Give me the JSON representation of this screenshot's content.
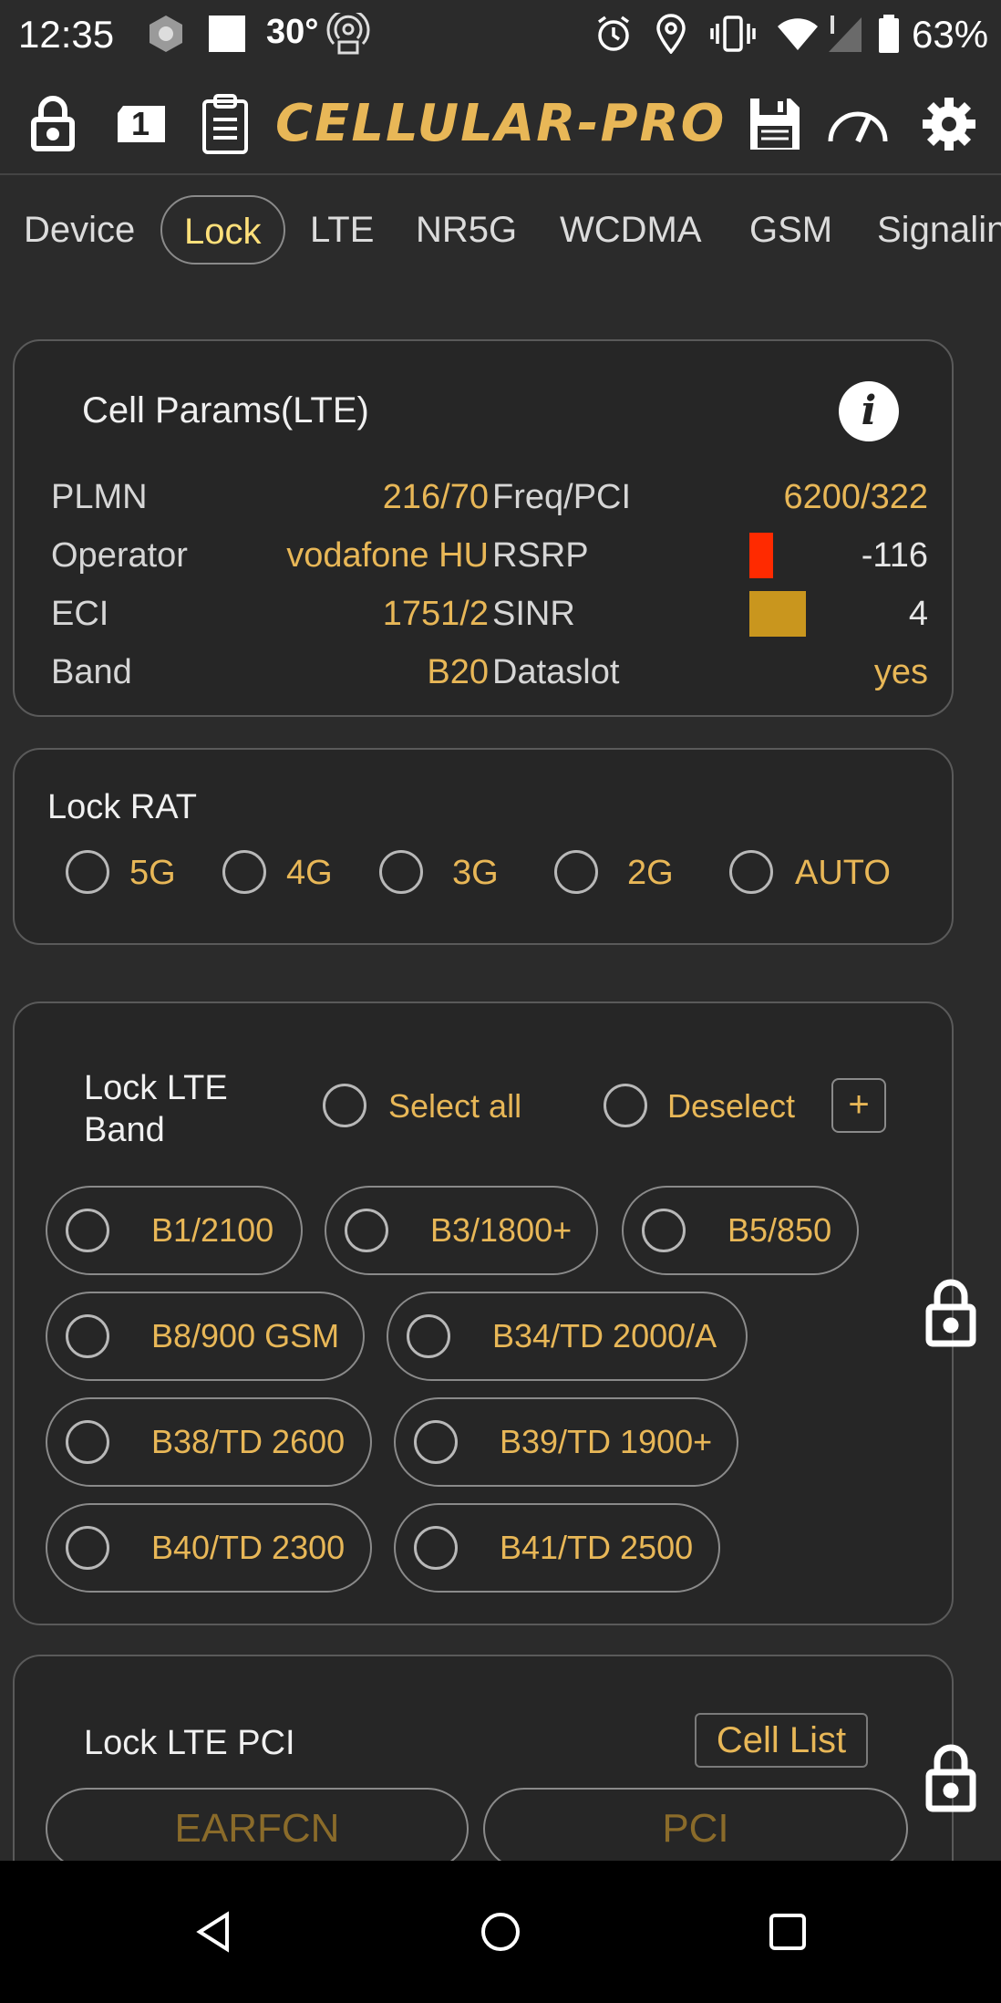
{
  "status_bar": {
    "time": "12:35",
    "temperature": "30°",
    "battery": "63%"
  },
  "toolbar": {
    "brand": "CELLULAR-PRO",
    "sim_slot": "1"
  },
  "tabs": [
    {
      "label": "Device"
    },
    {
      "label": "Lock"
    },
    {
      "label": "LTE"
    },
    {
      "label": "NR5G"
    },
    {
      "label": "WCDMA"
    },
    {
      "label": "GSM"
    },
    {
      "label": "Signalin"
    }
  ],
  "cell_params": {
    "title": "Cell Params(LTE)",
    "rows": [
      {
        "label": "PLMN",
        "value": "216/70",
        "label2": "Freq/PCI",
        "value2": "6200/322"
      },
      {
        "label": "Operator",
        "value": "vodafone HU",
        "label2": "RSRP",
        "value2": "-116"
      },
      {
        "label": "ECI",
        "value": "1751/2",
        "label2": "SINR",
        "value2": "4"
      },
      {
        "label": "Band",
        "value": "B20",
        "label2": "Dataslot",
        "value2": "yes"
      }
    ],
    "rsrp_color": "#ff2a00",
    "sinr_color": "#c9961e"
  },
  "lock_rat": {
    "title": "Lock RAT",
    "options": [
      "5G",
      "4G",
      "3G",
      "2G",
      "AUTO"
    ]
  },
  "lock_band": {
    "title_line1": "Lock LTE",
    "title_line2": "Band",
    "select_all": "Select all",
    "deselect": "Deselect",
    "add": "+",
    "bands": [
      "B1/2100",
      "B3/1800+",
      "B5/850",
      "B8/900 GSM",
      "B34/TD 2000/A",
      "B38/TD 2600",
      "B39/TD 1900+",
      "B40/TD 2300",
      "B41/TD 2500"
    ]
  },
  "lock_pci": {
    "title": "Lock LTE PCI",
    "cell_list": "Cell List",
    "earfcn_placeholder": "EARFCN",
    "pci_placeholder": "PCI"
  },
  "colors": {
    "accent": "#e8b757",
    "active_tab": "#ffe07a",
    "background": "#2b2b2b"
  }
}
